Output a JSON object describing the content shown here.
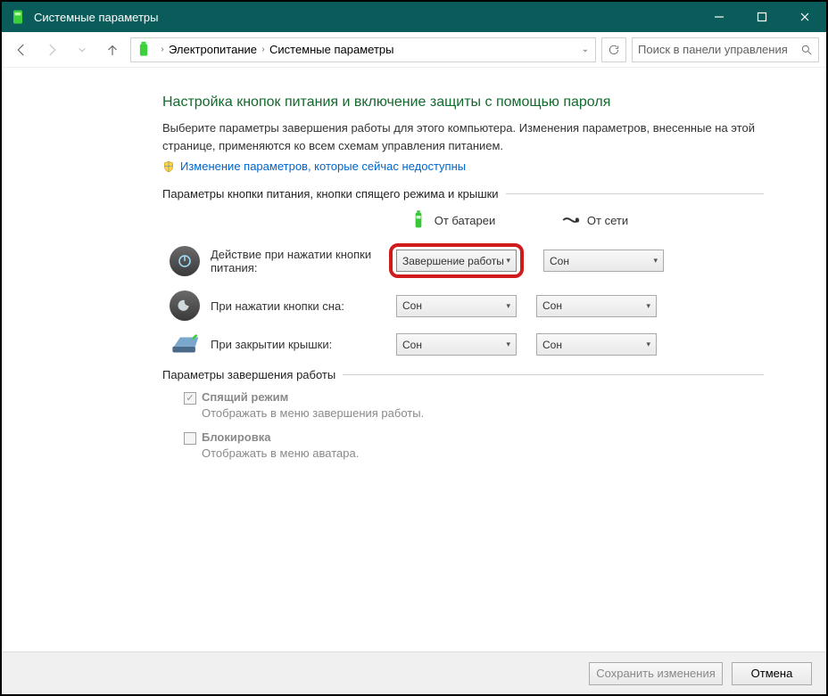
{
  "window": {
    "title": "Системные параметры"
  },
  "breadcrumb": {
    "item1": "Электропитание",
    "item2": "Системные параметры"
  },
  "search": {
    "placeholder": "Поиск в панели управления"
  },
  "page": {
    "heading": "Настройка кнопок питания и включение защиты с помощью пароля",
    "intro": "Выберите параметры завершения работы для этого компьютера. Изменения параметров, внесенные на этой странице, применяются ко всем схемам управления питанием.",
    "link": "Изменение параметров, которые сейчас недоступны"
  },
  "section1": {
    "title": "Параметры кнопки питания, кнопки спящего режима и крышки"
  },
  "columns": {
    "battery": "От батареи",
    "ac": "От сети"
  },
  "rows": {
    "power": {
      "label": "Действие при нажатии кнопки питания:",
      "battery": "Завершение работы",
      "ac": "Сон"
    },
    "sleep": {
      "label": "При нажатии кнопки сна:",
      "battery": "Сон",
      "ac": "Сон"
    },
    "lid": {
      "label": "При закрытии крышки:",
      "battery": "Сон",
      "ac": "Сон"
    }
  },
  "section2": {
    "title": "Параметры завершения работы"
  },
  "checkboxes": {
    "sleep": {
      "label": "Спящий режим",
      "desc": "Отображать в меню завершения работы."
    },
    "lock": {
      "label": "Блокировка",
      "desc": "Отображать в меню аватара."
    }
  },
  "footer": {
    "save": "Сохранить изменения",
    "cancel": "Отмена"
  }
}
